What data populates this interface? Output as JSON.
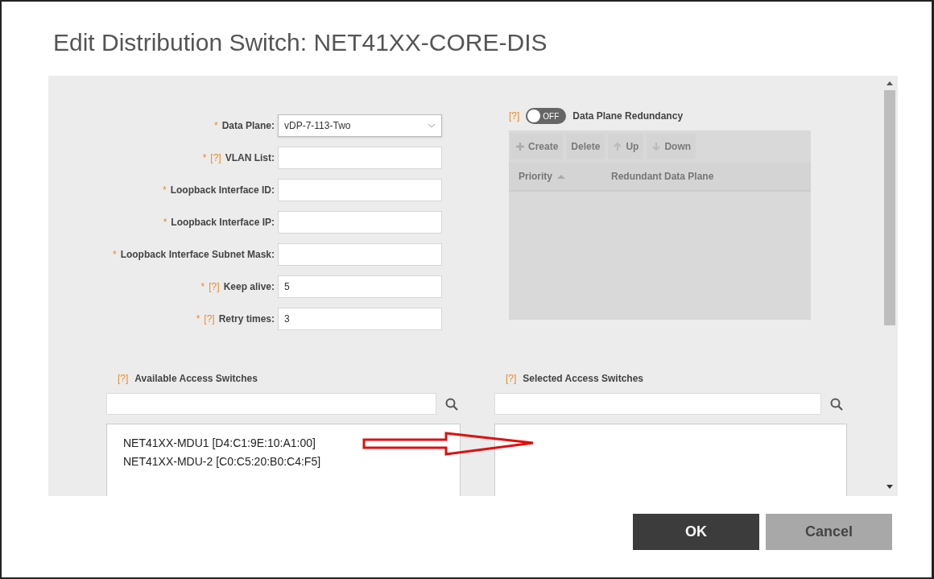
{
  "dialog": {
    "title": "Edit Distribution Switch: NET41XX-CORE-DIS"
  },
  "fields": [
    {
      "kind": "select",
      "marker": "*",
      "label": "Data Plane:",
      "value": "vDP-7-113-Two"
    },
    {
      "kind": "text",
      "marker": "*",
      "help": "[?]",
      "label": "VLAN List:"
    },
    {
      "kind": "text",
      "marker": "*",
      "label": "Loopback Interface ID:"
    },
    {
      "kind": "text",
      "marker": "*",
      "label": "Loopback Interface IP:"
    },
    {
      "kind": "text",
      "marker": "*",
      "label": "Loopback Interface Subnet Mask:"
    },
    {
      "kind": "text",
      "marker": "*",
      "help": "[?]",
      "label": "Keep alive:",
      "value": "5"
    },
    {
      "kind": "text",
      "marker": "*",
      "help": "[?]",
      "label": "Retry times:",
      "value": "3"
    }
  ],
  "redundancy": {
    "help": "[?]",
    "on": false,
    "state_label": "OFF",
    "label": "Data Plane Redundancy",
    "toolbar": [
      {
        "kind": "create",
        "label": "Create",
        "disabled": true
      },
      {
        "kind": "delete",
        "label": "Delete",
        "disabled": true
      },
      {
        "kind": "up",
        "label": "Up",
        "disabled": true
      },
      {
        "kind": "down",
        "label": "Down",
        "disabled": true
      }
    ],
    "columns": [
      {
        "label": "Priority",
        "sorted": true
      },
      {
        "label": "Redundant Data Plane",
        "sorted": false
      }
    ]
  },
  "available": {
    "help": "[?]",
    "label": "Available Access Switches",
    "items": [
      "NET41XX-MDU1 [D4:C1:9E:10:A1:00]",
      "NET41XX-MDU-2 [C0:C5:20:B0:C4:F5]"
    ]
  },
  "selected": {
    "help": "[?]",
    "label": "Selected Access Switches"
  },
  "buttons": [
    {
      "kind": "primary",
      "label": "OK"
    },
    {
      "kind": "secondary",
      "label": "Cancel"
    }
  ]
}
